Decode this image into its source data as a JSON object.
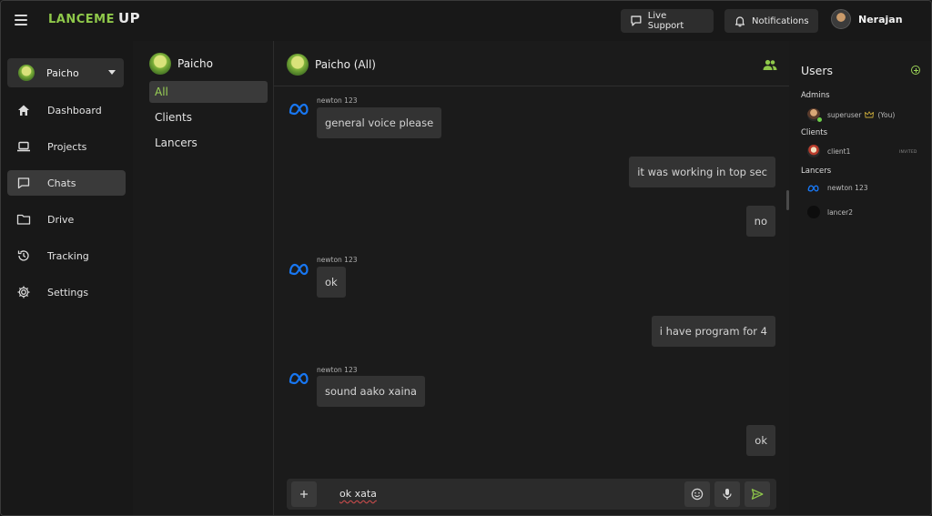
{
  "app": {
    "logo_text": "LANCEME",
    "logo_suffix": "UP"
  },
  "topbar": {
    "live_support_label": "Live Support",
    "notifications_label": "Notifications",
    "user_name": "Nerajan"
  },
  "sidebar": {
    "workspace": "Paicho",
    "items": [
      {
        "label": "Dashboard",
        "icon": "home-icon"
      },
      {
        "label": "Projects",
        "icon": "laptop-icon"
      },
      {
        "label": "Chats",
        "icon": "chat-icon",
        "active": true
      },
      {
        "label": "Drive",
        "icon": "folder-icon"
      },
      {
        "label": "Tracking",
        "icon": "history-icon"
      },
      {
        "label": "Settings",
        "icon": "gear-icon"
      }
    ]
  },
  "channels": {
    "header": "Paicho",
    "items": [
      {
        "label": "All",
        "active": true
      },
      {
        "label": "Clients"
      },
      {
        "label": "Lancers"
      }
    ]
  },
  "chat": {
    "title": "Paicho (All)",
    "messages": [
      {
        "sender": "newton 123",
        "text": "general voice please",
        "side": "left"
      },
      {
        "text": "it was working in top sec",
        "side": "right"
      },
      {
        "text": "no",
        "side": "right"
      },
      {
        "sender": "newton 123",
        "text": "ok",
        "side": "left"
      },
      {
        "text": "i have program for 4",
        "side": "right"
      },
      {
        "sender": "newton 123",
        "text": "sound aako xaina",
        "side": "left"
      },
      {
        "text": "ok",
        "side": "right"
      }
    ],
    "composer_value": "ok xata"
  },
  "users_panel": {
    "title": "Users",
    "groups": {
      "admins": "Admins",
      "clients": "Clients",
      "lancers": "Lancers"
    },
    "admin": {
      "name": "superuser",
      "you_label": "(You)"
    },
    "client": {
      "name": "client1",
      "status": "INVITED"
    },
    "lancers": [
      {
        "name": "newton 123"
      },
      {
        "name": "lancer2"
      }
    ]
  },
  "colors": {
    "accent": "#9ad156",
    "meta_blue": "#1877f2"
  }
}
